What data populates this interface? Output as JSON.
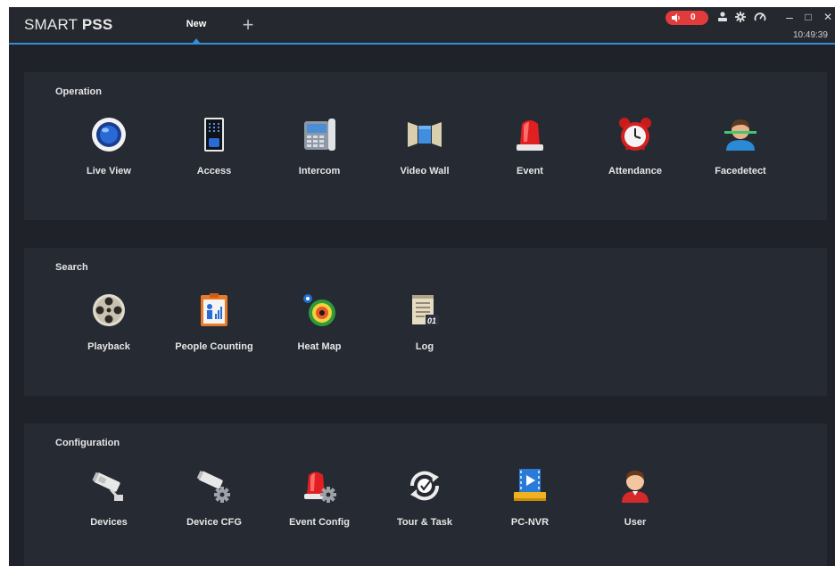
{
  "app": {
    "title_light": "SMART ",
    "title_bold": "PSS",
    "clock": "10:49:39"
  },
  "tabs": [
    {
      "label": "New"
    }
  ],
  "add_tab_label": "+",
  "alarm": {
    "count": "0"
  },
  "window": {
    "minimize": "–",
    "maximize": "□",
    "close": "✕"
  },
  "sections": {
    "operation": {
      "title": "Operation",
      "items": [
        {
          "label": "Live View",
          "icon": "camera-lens-icon"
        },
        {
          "label": "Access",
          "icon": "access-panel-icon"
        },
        {
          "label": "Intercom",
          "icon": "intercom-phone-icon"
        },
        {
          "label": "Video Wall",
          "icon": "video-wall-icon"
        },
        {
          "label": "Event",
          "icon": "siren-icon"
        },
        {
          "label": "Attendance",
          "icon": "alarm-clock-icon"
        },
        {
          "label": "Facedetect",
          "icon": "face-scan-icon"
        }
      ]
    },
    "search": {
      "title": "Search",
      "items": [
        {
          "label": "Playback",
          "icon": "film-reel-icon"
        },
        {
          "label": "People Counting",
          "icon": "people-chart-icon"
        },
        {
          "label": "Heat Map",
          "icon": "heat-map-icon"
        },
        {
          "label": "Log",
          "icon": "log-notepad-icon"
        }
      ]
    },
    "configuration": {
      "title": "Configuration",
      "items": [
        {
          "label": "Devices",
          "icon": "cctv-camera-icon"
        },
        {
          "label": "Device CFG",
          "icon": "camera-gear-icon"
        },
        {
          "label": "Event Config",
          "icon": "siren-gear-icon"
        },
        {
          "label": "Tour & Task",
          "icon": "tour-sync-icon"
        },
        {
          "label": "PC-NVR",
          "icon": "pc-nvr-icon"
        },
        {
          "label": "User",
          "icon": "user-icon"
        }
      ]
    }
  },
  "colors": {
    "accent": "#2f8fd8",
    "alarm": "#e23b3b",
    "background": "#1f2228",
    "panel": "#262a32"
  }
}
